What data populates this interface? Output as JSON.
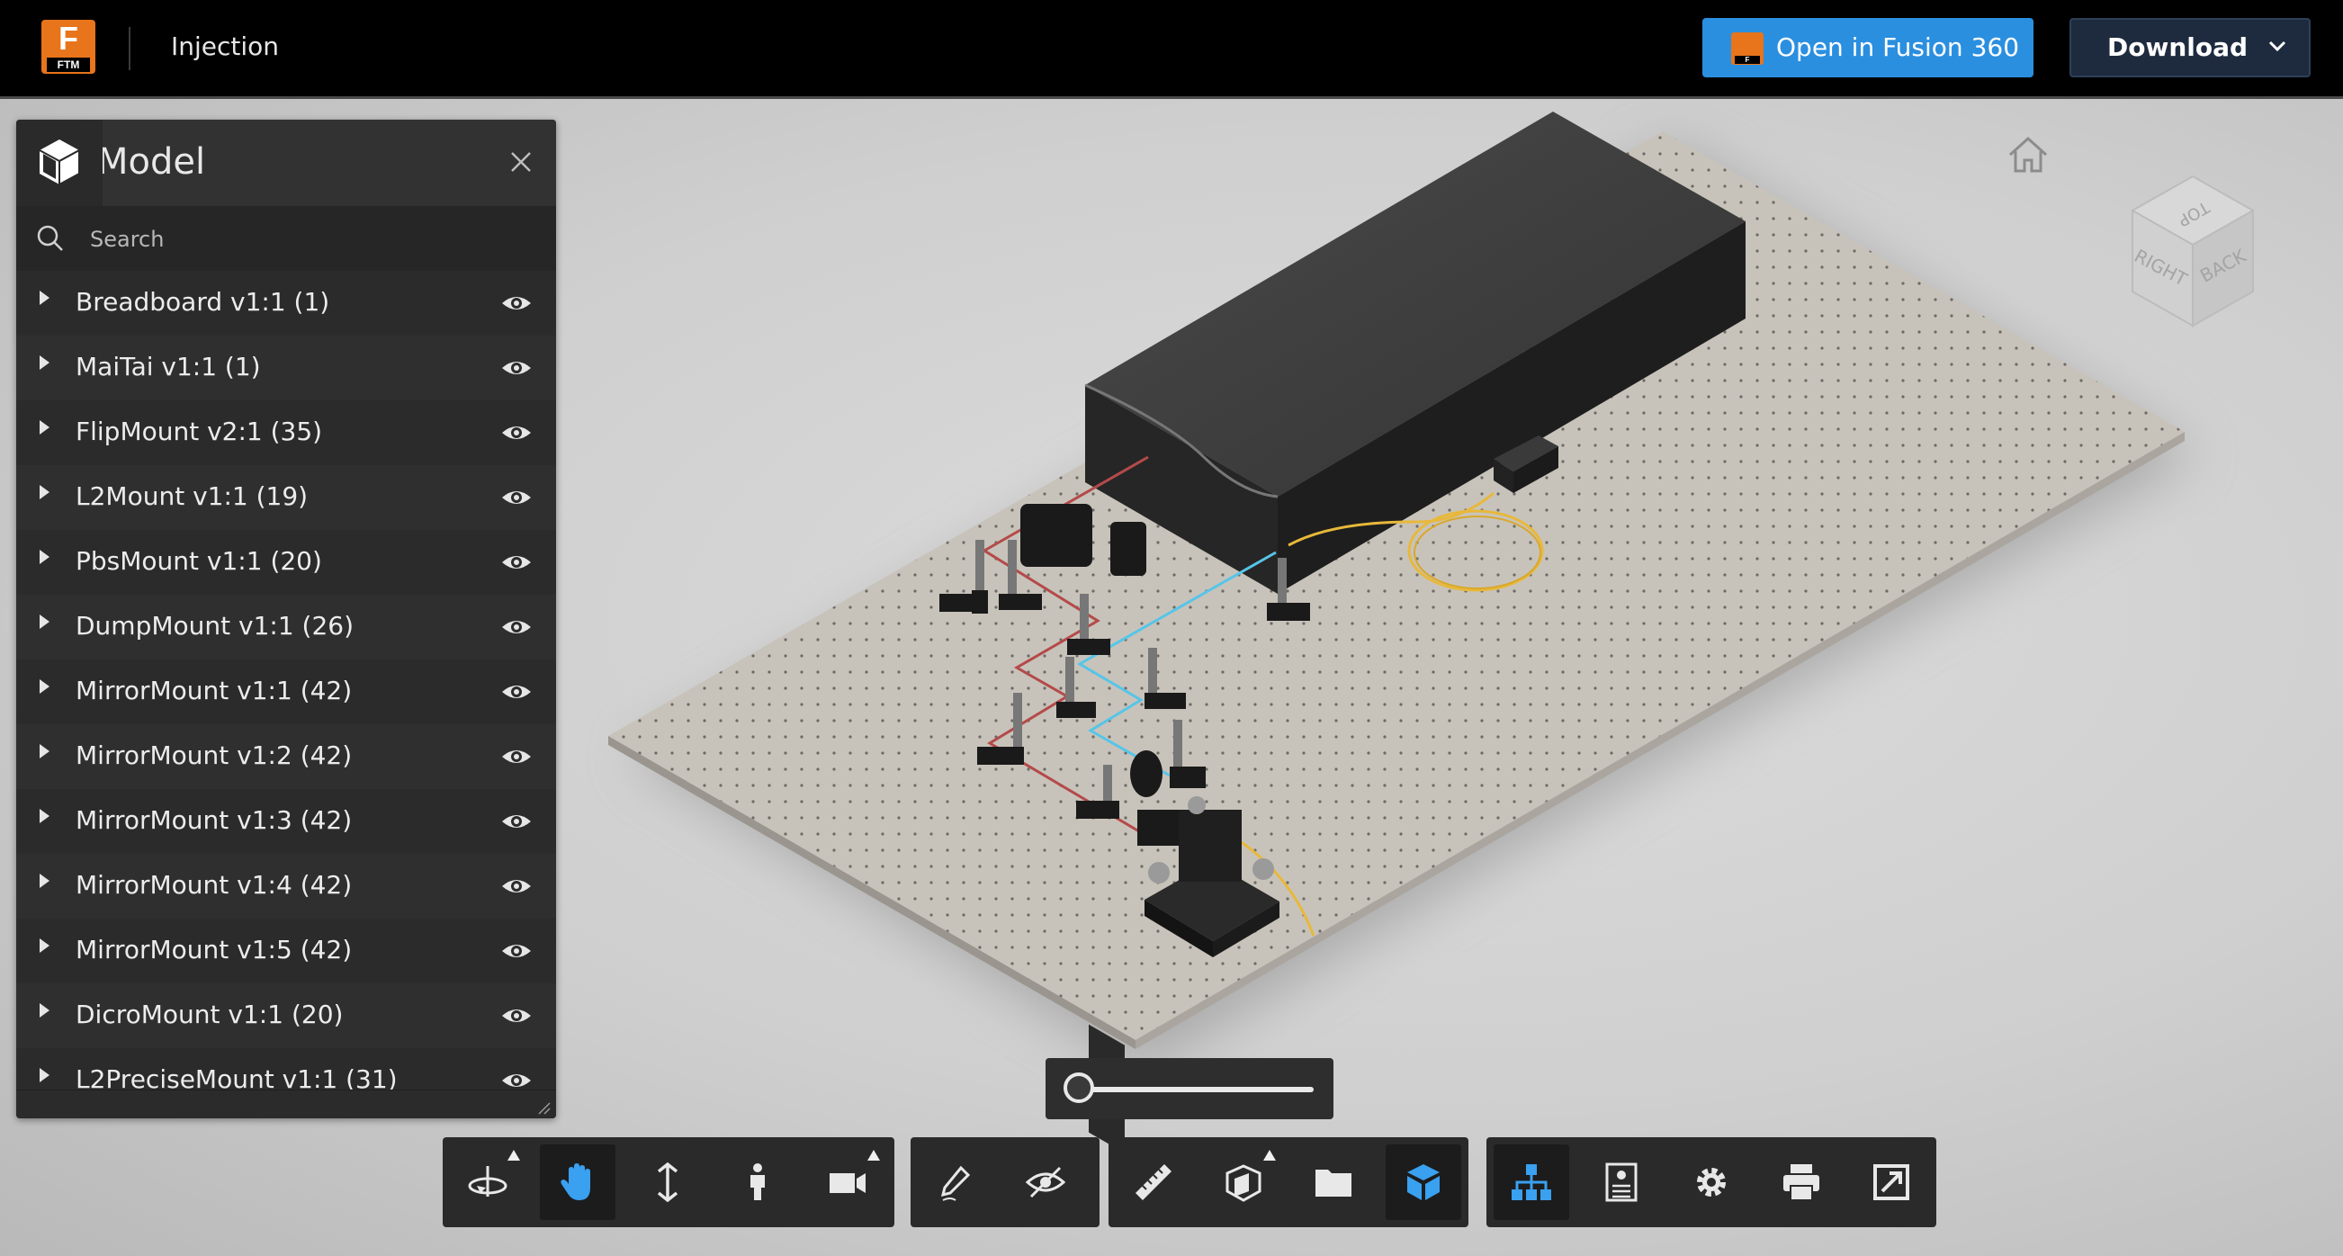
{
  "app": {
    "logo_text": "F",
    "logo_sub": "FTM",
    "document_title": "Injection"
  },
  "header": {
    "open_fusion_label": "Open in Fusion 360",
    "fusion_badge": "F",
    "fusion_badge_sub": "360",
    "download_label": "Download"
  },
  "panel": {
    "title": "Model",
    "search_placeholder": "Search",
    "items": [
      {
        "label": "Breadboard v1:1 (1)"
      },
      {
        "label": "MaiTai v1:1 (1)"
      },
      {
        "label": "FlipMount v2:1 (35)"
      },
      {
        "label": "L2Mount v1:1 (19)"
      },
      {
        "label": "PbsMount v1:1 (20)"
      },
      {
        "label": "DumpMount v1:1 (26)"
      },
      {
        "label": "MirrorMount v1:1 (42)"
      },
      {
        "label": "MirrorMount v1:2 (42)"
      },
      {
        "label": "MirrorMount v1:3 (42)"
      },
      {
        "label": "MirrorMount v1:4 (42)"
      },
      {
        "label": "MirrorMount v1:5 (42)"
      },
      {
        "label": "DicroMount v1:1 (20)"
      },
      {
        "label": "L2PreciseMount v1:1 (31)"
      }
    ]
  },
  "viewcube": {
    "top": "TOP",
    "right": "RIGHT",
    "back": "BACK"
  },
  "explode_slider": {
    "value": 0
  },
  "toolbar": {
    "icons": [
      "orbit-icon",
      "pan-icon",
      "zoom-icon",
      "first-person-icon",
      "camera-icon",
      "markup-icon",
      "visibility-icon",
      "measure-icon",
      "section-icon",
      "explode-icon",
      "model-browser-icon",
      "model-structure-icon",
      "properties-icon",
      "settings-icon",
      "print-icon",
      "fullscreen-icon"
    ],
    "active": [
      "pan-icon",
      "model-browser-icon",
      "model-structure-icon"
    ]
  },
  "colors": {
    "accent_blue": "#2b8fe0",
    "brand_orange": "#e8741b",
    "download_bg": "#1e2b3f",
    "active_icon": "#3aa0f0"
  }
}
